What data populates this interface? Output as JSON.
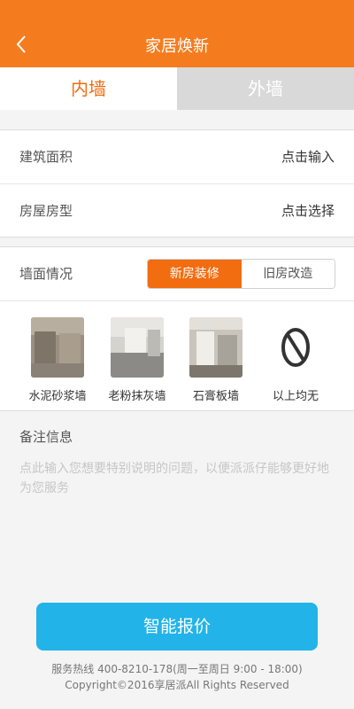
{
  "header": {
    "title": "家居焕新",
    "back_icon": "chevron-left-icon",
    "background_color": "#f57c1e"
  },
  "tabs": [
    {
      "label": "内墙",
      "active": true
    },
    {
      "label": "外墙",
      "active": false
    }
  ],
  "form": {
    "area": {
      "label": "建筑面积",
      "value": "点击输入"
    },
    "house_type": {
      "label": "房屋房型",
      "value": "点击选择"
    }
  },
  "wall": {
    "label": "墙面情况",
    "options": [
      {
        "label": "新房装修",
        "selected": true
      },
      {
        "label": "旧房改造",
        "selected": false
      }
    ],
    "types": [
      {
        "label": "水泥砂浆墙",
        "icon": "cement-wall-photo"
      },
      {
        "label": "老粉抹灰墙",
        "icon": "plaster-wall-photo"
      },
      {
        "label": "石膏板墙",
        "icon": "gypsum-board-photo"
      },
      {
        "label": "以上均无",
        "icon": "none-icon"
      }
    ]
  },
  "notes": {
    "title": "备注信息",
    "placeholder": "点此输入您想要特别说明的问题，以便派派仔能够更好地为您服务"
  },
  "cta": {
    "label": "智能报价",
    "color": "#22b4e8"
  },
  "footer": {
    "hotline": "服务热线 400-8210-178(周一至周日 9:00 - 18:00)",
    "copyright": "Copyright©2016享居派All Rights Reserved"
  },
  "accent_color": "#f26c10"
}
